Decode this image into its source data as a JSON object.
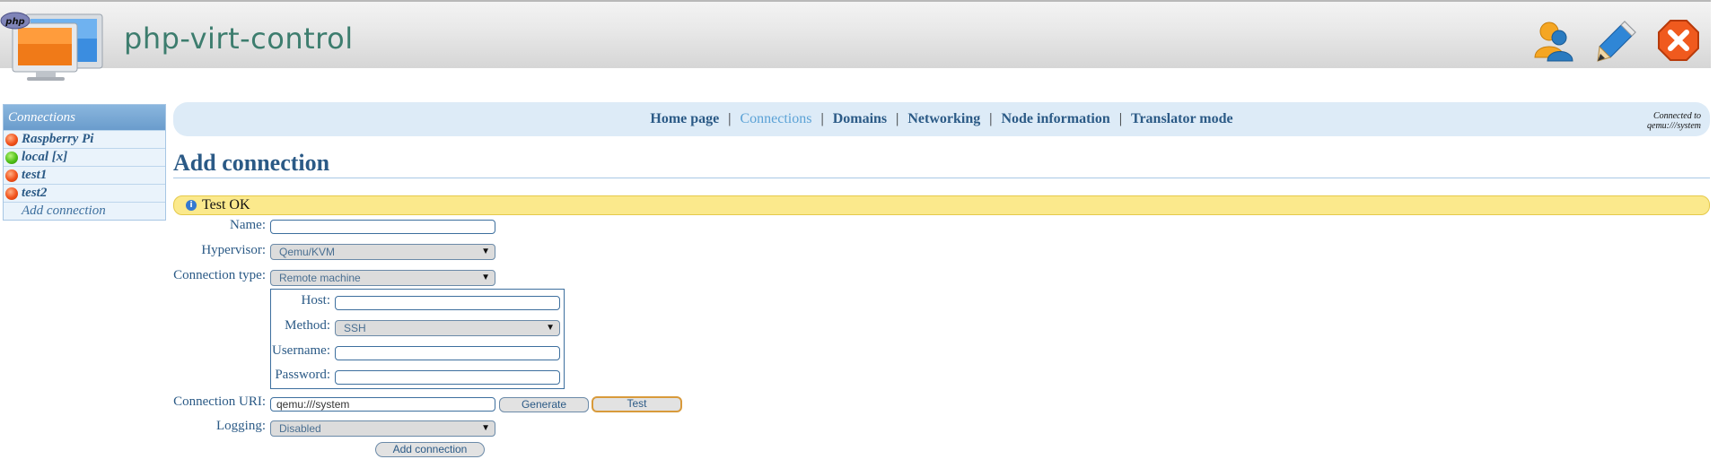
{
  "header": {
    "logo_badge": "php",
    "app_title": "php-virt-control",
    "icons": [
      "user-settings-icon",
      "edit-pencil-icon",
      "logout-close-icon"
    ]
  },
  "sidebar": {
    "header": "Connections",
    "items": [
      {
        "label": "Raspberry Pi",
        "status": "red"
      },
      {
        "label": "local [x]",
        "status": "green"
      },
      {
        "label": "test1",
        "status": "red"
      },
      {
        "label": "test2",
        "status": "red"
      }
    ],
    "add_label": "Add connection"
  },
  "nav": {
    "links": [
      "Home page",
      "Connections",
      "Domains",
      "Networking",
      "Node information",
      "Translator mode"
    ],
    "active": "Connections",
    "separator": "|",
    "status_line1": "Connected to",
    "status_line2": "qemu:///system"
  },
  "page": {
    "title": "Add connection",
    "notice": "Test OK"
  },
  "form": {
    "name_label": "Name:",
    "name_value": "",
    "hypervisor_label": "Hypervisor:",
    "hypervisor_value": "Qemu/KVM",
    "conn_type_label": "Connection type:",
    "conn_type_value": "Remote machine",
    "host_label": "Host:",
    "host_value": "",
    "method_label": "Method:",
    "method_value": "SSH",
    "username_label": "Username:",
    "username_value": "",
    "password_label": "Password:",
    "password_value": "",
    "uri_label": "Connection URI:",
    "uri_value": "qemu:///system",
    "generate_label": "Generate",
    "test_label": "Test",
    "logging_label": "Logging:",
    "logging_value": "Disabled",
    "submit_label": "Add connection"
  },
  "colors": {
    "accent": "#2b5a86",
    "active_link": "#5ba2d6",
    "notice_bg": "#fbe98c",
    "status_offline": "#f1511a",
    "status_online": "#4fbf16"
  }
}
